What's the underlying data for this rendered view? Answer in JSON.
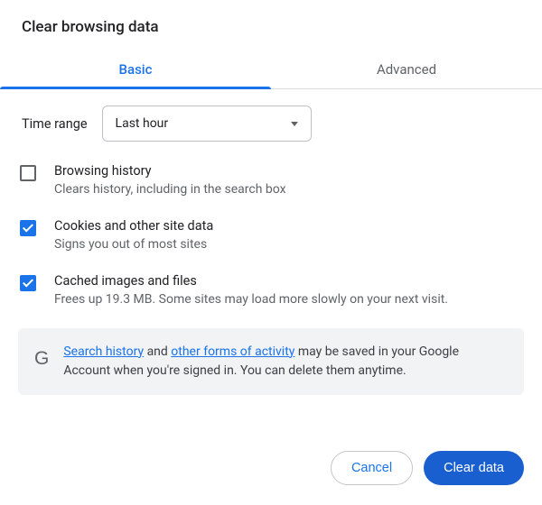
{
  "title": "Clear browsing data",
  "tabs": {
    "basic": "Basic",
    "advanced": "Advanced"
  },
  "time_range": {
    "label": "Time range",
    "value": "Last hour"
  },
  "options": [
    {
      "title": "Browsing history",
      "desc": "Clears history, including in the search box",
      "checked": false
    },
    {
      "title": "Cookies and other site data",
      "desc": "Signs you out of most sites",
      "checked": true
    },
    {
      "title": "Cached images and files",
      "desc": "Frees up 19.3 MB. Some sites may load more slowly on your next visit.",
      "checked": true
    }
  ],
  "info": {
    "link1": "Search history",
    "mid1": " and ",
    "link2": "other forms of activity",
    "rest": " may be saved in your Google Account when you're signed in. You can delete them anytime."
  },
  "buttons": {
    "cancel": "Cancel",
    "clear": "Clear data"
  }
}
